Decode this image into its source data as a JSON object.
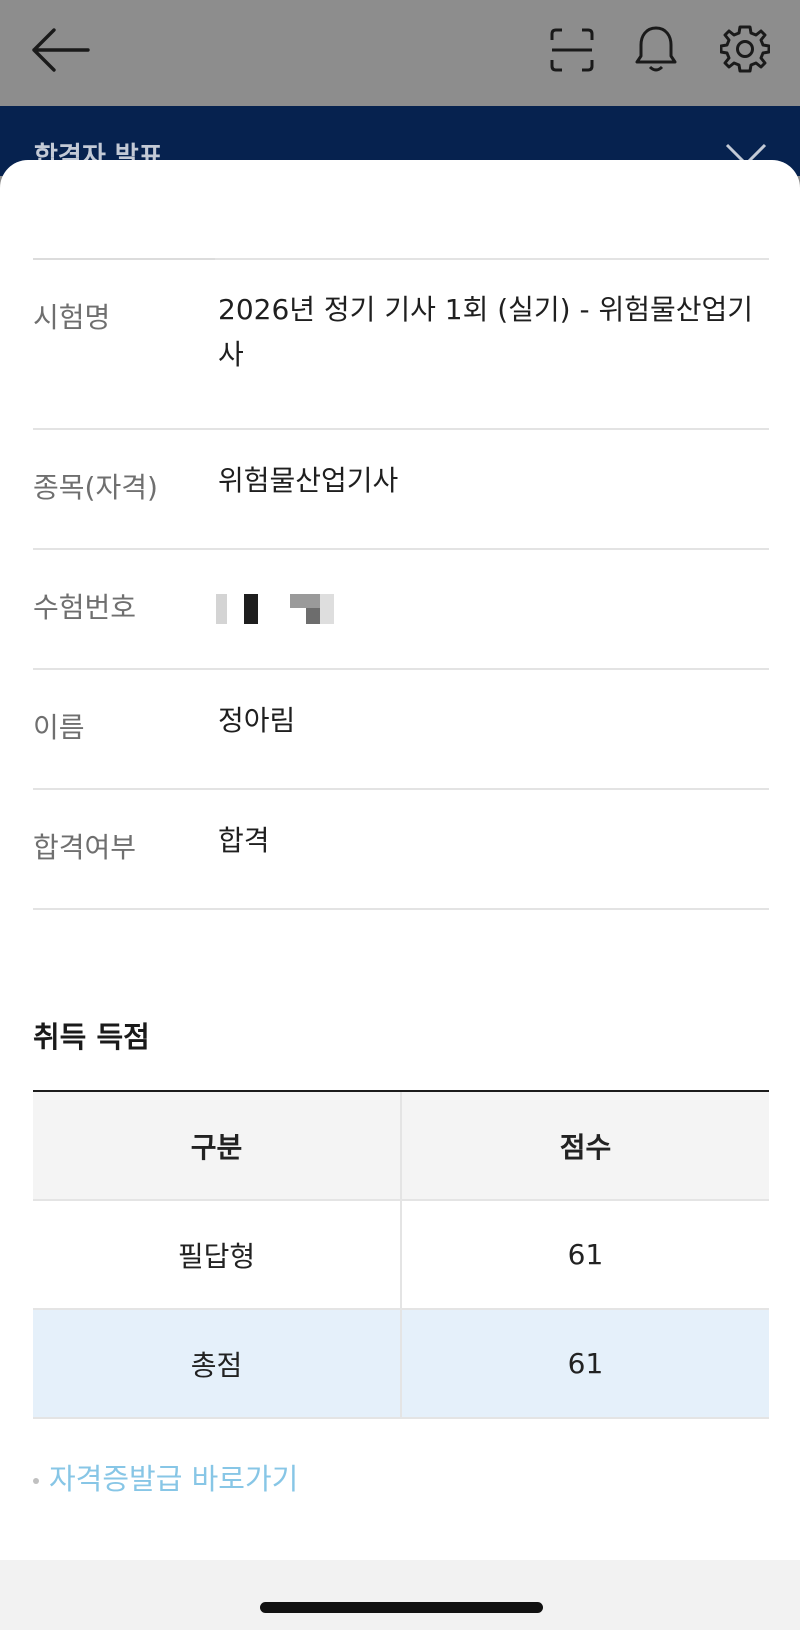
{
  "header": {
    "banner_title": "합격자 발표"
  },
  "details": {
    "rows": [
      {
        "label": "시험명",
        "value": "2026년 정기 기사 1회 (실기) - 위험물산업기사"
      },
      {
        "label": "종목(자격)",
        "value": "위험물산업기사"
      },
      {
        "label": "수험번호",
        "value": ""
      },
      {
        "label": "이름",
        "value": "정아림"
      },
      {
        "label": "합격여부",
        "value": "합격"
      }
    ]
  },
  "scores": {
    "title": "취득 득점",
    "columns": [
      "구분",
      "점수"
    ],
    "rows": [
      {
        "category": "필답형",
        "score": "61"
      },
      {
        "category": "총점",
        "score": "61"
      }
    ]
  },
  "link": {
    "label": "자격증발급 바로가기",
    "color": "#87c6e6"
  },
  "colors": {
    "banner": "#06224f",
    "highlight_row": "#e5f0fa"
  }
}
